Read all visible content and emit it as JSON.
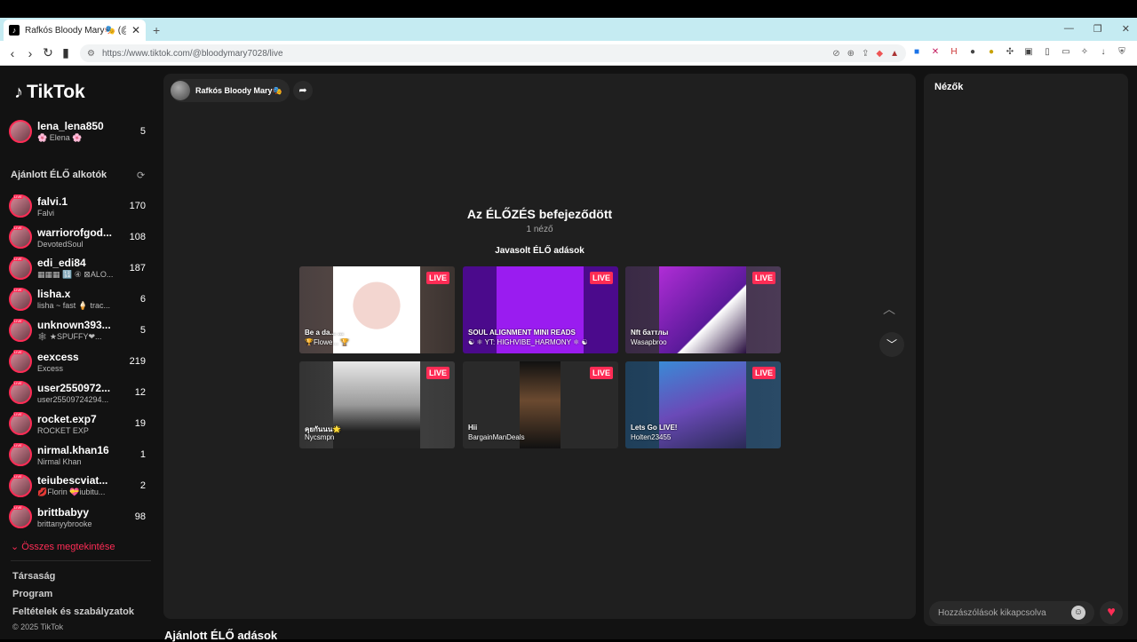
{
  "browser": {
    "tab_title": "Rafkós Bloody Mary🎭 (@bloo",
    "url": "https://www.tiktok.com/@bloodymary7028/live"
  },
  "sidebar": {
    "logo": "TikTok",
    "followed": {
      "name": "lena_lena850",
      "sub": "🌸 Elena 🌸",
      "count": "5"
    },
    "section_title": "Ajánlott ÉLŐ alkotók",
    "creators": [
      {
        "name": "falvi.1",
        "sub": "Falvi",
        "count": "170"
      },
      {
        "name": "warriorofgod...",
        "sub": "DevotedSoul",
        "count": "108"
      },
      {
        "name": "edi_edi84",
        "sub": "▦▦▦ 🔢 ④ ⊠ALO...",
        "count": "187"
      },
      {
        "name": "lisha.x",
        "sub": "lisha ~ fast 🍦 trac...",
        "count": "6"
      },
      {
        "name": "unknown393...",
        "sub": "🕸 ★SPUFFY❤...",
        "count": "5"
      },
      {
        "name": "eexcess",
        "sub": "Excess",
        "count": "219"
      },
      {
        "name": "user2550972...",
        "sub": "user25509724294...",
        "count": "12"
      },
      {
        "name": "rocket.exp7",
        "sub": "ROCKET EXP",
        "count": "19"
      },
      {
        "name": "nirmal.khan16",
        "sub": "Nirmal Khan",
        "count": "1"
      },
      {
        "name": "teiubescviat...",
        "sub": "💋Florin 💝iubitu...",
        "count": "2"
      },
      {
        "name": "brittbabyy",
        "sub": "brittanyybrooke",
        "count": "98"
      }
    ],
    "see_all": "Összes megtekintése",
    "footer": [
      "Társaság",
      "Program",
      "Feltételek és szabályzatok"
    ],
    "copyright": "© 2025 TikTok"
  },
  "main": {
    "host_name": "Rafkós Bloody Mary🎭",
    "ended_title": "Az ÉLŐZÉS befejeződött",
    "viewer_count": "1 néző",
    "suggested_title": "Javasolt ÉLŐ adások",
    "live_badge": "LIVE",
    "cards": [
      {
        "title": "Be a da... ...",
        "subtitle": "🏆Flowe... 🏆"
      },
      {
        "title": "SOUL ALIGNMENT MINI READS",
        "subtitle": "☯ ⚛ YT: HIGHVIBE_HARMONY ⚛ ☯"
      },
      {
        "title": "Nft баттлы",
        "subtitle": "Wasapbroo"
      },
      {
        "title": "คุยกันนน🌟",
        "subtitle": "Nycsmpn"
      },
      {
        "title": "Hii",
        "subtitle": "BargainManDeals"
      },
      {
        "title": "Lets Go LIVE!",
        "subtitle": "Holten23455"
      }
    ]
  },
  "below_title": "Ajánlott ÉLŐ adások",
  "viewers_panel": {
    "title": "Nézők",
    "comment_placeholder": "Hozzászólások kikapcsolva"
  },
  "colors": {
    "accent": "#fe2c55",
    "panel": "#1f1f1f",
    "background": "#121212"
  }
}
